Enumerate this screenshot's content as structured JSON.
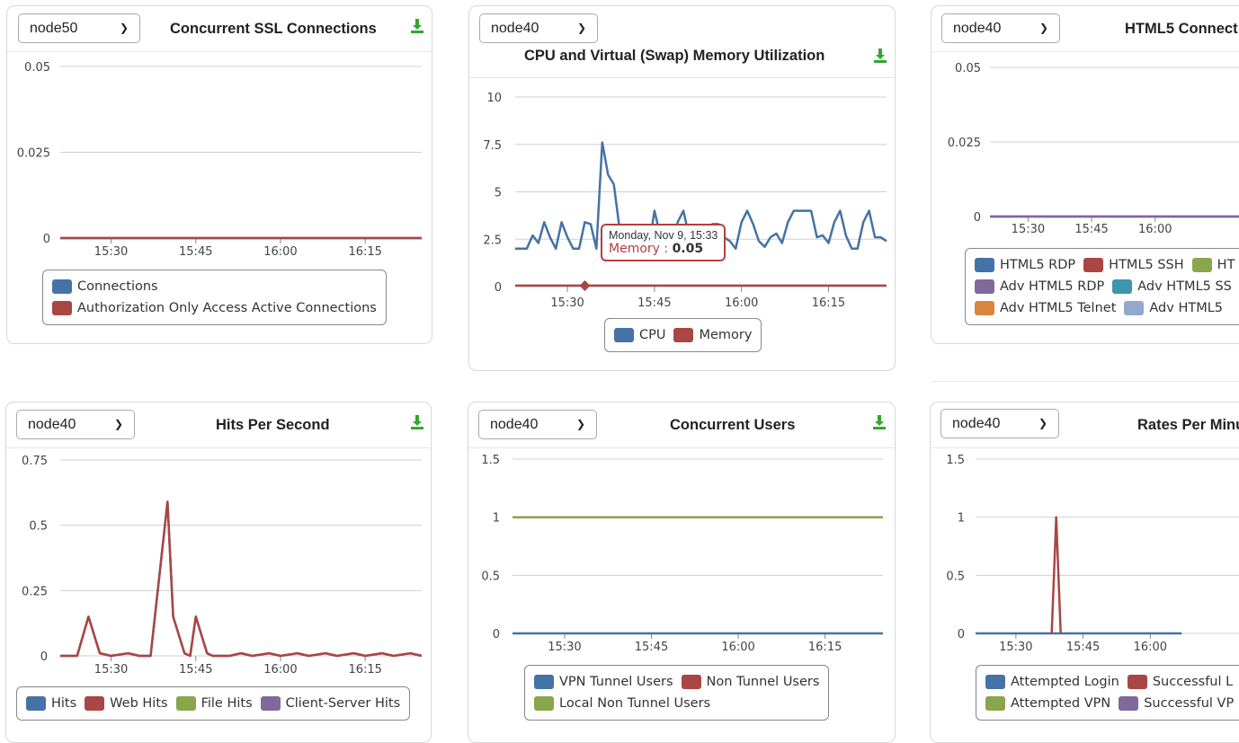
{
  "colors": {
    "blue": "#4572a7",
    "red": "#aa4643",
    "green": "#89a54e",
    "purple": "#80699b",
    "teal": "#3d96ae",
    "orange": "#db843d",
    "lightblue": "#92a8cd",
    "download": "#33a532"
  },
  "panels": [
    {
      "node": "node50",
      "title": "Concurrent SSL Connections",
      "icon": "download-icon",
      "legend_rows": [
        [
          "Connections"
        ],
        [
          "Authorization Only Access Active Connections"
        ]
      ],
      "legend_colors": [
        [
          "blue"
        ],
        [
          "red"
        ]
      ]
    },
    {
      "node": "node40",
      "title": "CPU and Virtual (Swap) Memory Utilization",
      "icon": "download-icon",
      "legend_rows": [
        [
          "CPU",
          "Memory"
        ]
      ],
      "legend_colors": [
        [
          "blue",
          "red"
        ]
      ],
      "tooltip": {
        "date": "Monday, Nov 9, 15:33",
        "series": "Memory",
        "value": "0.05"
      }
    },
    {
      "node": "node40",
      "title": "HTML5 Connect",
      "legend_rows": [
        [
          "HTML5 RDP",
          "HTML5 SSH",
          "HT"
        ],
        [
          "Adv HTML5 RDP",
          "Adv HTML5 SS"
        ],
        [
          "Adv HTML5 Telnet",
          "Adv HTML5"
        ]
      ],
      "legend_colors": [
        [
          "blue",
          "red",
          "green"
        ],
        [
          "purple",
          "teal"
        ],
        [
          "orange",
          "lightblue"
        ]
      ]
    },
    {
      "node": "node40",
      "title": "Hits Per Second",
      "icon": "download-icon",
      "legend_rows": [
        [
          "Hits",
          "Web Hits",
          "File Hits",
          "Client-Server Hits"
        ]
      ],
      "legend_colors": [
        [
          "blue",
          "red",
          "green",
          "purple"
        ]
      ]
    },
    {
      "node": "node40",
      "title": "Concurrent Users",
      "icon": "download-icon",
      "legend_rows": [
        [
          "VPN Tunnel Users",
          "Non Tunnel Users"
        ],
        [
          "Local Non Tunnel Users"
        ]
      ],
      "legend_colors": [
        [
          "blue",
          "red"
        ],
        [
          "green"
        ]
      ]
    },
    {
      "node": "node40",
      "title": "Rates Per Minu",
      "legend_rows": [
        [
          "Attempted Login",
          "Successful L"
        ],
        [
          "Attempted VPN",
          "Successful VP"
        ]
      ],
      "legend_colors": [
        [
          "blue",
          "red"
        ],
        [
          "green",
          "purple"
        ]
      ]
    }
  ],
  "chart_data": [
    {
      "type": "line",
      "title": "Concurrent SSL Connections",
      "ylim": [
        0,
        0.05
      ],
      "yticks": [
        "0.05",
        "0.025",
        "0"
      ],
      "xticks": [
        "15:30",
        "15:45",
        "16:00",
        "16:15"
      ],
      "x_range": [
        "15:21",
        "16:25"
      ],
      "series": [
        {
          "name": "Connections",
          "color": "blue",
          "x": [
            "15:21",
            "16:25"
          ],
          "y": [
            0,
            0
          ]
        },
        {
          "name": "Authorization Only Access Active Connections",
          "color": "red",
          "x": [
            "15:21",
            "16:25"
          ],
          "y": [
            0,
            0
          ]
        }
      ]
    },
    {
      "type": "line",
      "title": "CPU and Virtual (Swap) Memory Utilization",
      "ylim": [
        0,
        10
      ],
      "yticks": [
        "10",
        "7.5",
        "5",
        "2.5",
        "0"
      ],
      "xticks": [
        "15:30",
        "15:45",
        "16:00",
        "16:15"
      ],
      "x_range": [
        "15:21",
        "16:25"
      ],
      "series": [
        {
          "name": "CPU",
          "color": "blue",
          "x": [
            "15:21",
            "15:22",
            "15:23",
            "15:24",
            "15:25",
            "15:26",
            "15:27",
            "15:28",
            "15:29",
            "15:30",
            "15:31",
            "15:32",
            "15:33",
            "15:34",
            "15:35",
            "15:36",
            "15:37",
            "15:38",
            "15:39",
            "15:40",
            "15:41",
            "15:42",
            "15:43",
            "15:44",
            "15:45",
            "15:46",
            "15:47",
            "15:48",
            "15:49",
            "15:50",
            "15:51",
            "15:52",
            "15:53",
            "15:54",
            "15:55",
            "15:56",
            "15:57",
            "15:58",
            "15:59",
            "16:00",
            "16:01",
            "16:02",
            "16:03",
            "16:04",
            "16:05",
            "16:06",
            "16:07",
            "16:08",
            "16:09",
            "16:10",
            "16:11",
            "16:12",
            "16:13",
            "16:14",
            "16:15",
            "16:16",
            "16:17",
            "16:18",
            "16:19",
            "16:20",
            "16:21",
            "16:22",
            "16:23",
            "16:24",
            "16:25"
          ],
          "y": [
            2.0,
            2.0,
            2.0,
            2.7,
            2.3,
            3.4,
            2.6,
            2.0,
            3.4,
            2.6,
            2.0,
            2.0,
            3.4,
            3.3,
            2.0,
            7.6,
            5.9,
            5.4,
            3.0,
            2.6,
            2.0,
            2.0,
            2.6,
            2.0,
            4.0,
            2.7,
            2.0,
            2.0,
            3.4,
            4.0,
            2.6,
            2.0,
            2.7,
            2.0,
            3.3,
            3.3,
            2.6,
            2.4,
            2.0,
            3.4,
            4.0,
            3.3,
            2.4,
            2.1,
            2.6,
            2.8,
            2.3,
            3.4,
            4.0,
            4.0,
            4.0,
            4.0,
            2.6,
            2.7,
            2.3,
            3.4,
            4.0,
            2.7,
            2.0,
            2.0,
            3.4,
            4.0,
            2.6,
            2.6,
            2.4
          ]
        },
        {
          "name": "Memory",
          "color": "red",
          "x": [
            "15:21",
            "16:25"
          ],
          "y": [
            0.05,
            0.05
          ]
        }
      ]
    },
    {
      "type": "line",
      "title": "HTML5 Connect",
      "ylim": [
        0,
        0.05
      ],
      "yticks": [
        "0.05",
        "0.025",
        "0"
      ],
      "xticks": [
        "15:30",
        "15:45",
        "16:00"
      ],
      "series": [
        {
          "name": "HTML5 RDP",
          "color": "blue",
          "y": [
            0,
            0
          ]
        },
        {
          "name": "Adv HTML5 RDP",
          "color": "purple",
          "y": [
            0,
            0
          ]
        }
      ]
    },
    {
      "type": "line",
      "title": "Hits Per Second",
      "ylim": [
        0,
        0.75
      ],
      "yticks": [
        "0.75",
        "0.5",
        "0.25",
        "0"
      ],
      "xticks": [
        "15:30",
        "15:45",
        "16:00",
        "16:15"
      ],
      "x_range": [
        "15:21",
        "16:25"
      ],
      "series": [
        {
          "name": "Hits",
          "color": "blue",
          "x": [
            "15:21",
            "15:24",
            "15:26",
            "15:28",
            "15:30",
            "15:33",
            "15:35",
            "15:37",
            "15:40",
            "15:41",
            "15:43",
            "15:44",
            "15:45",
            "15:47",
            "15:48",
            "15:51",
            "15:53",
            "15:55",
            "15:58",
            "16:00",
            "16:03",
            "16:05",
            "16:08",
            "16:10",
            "16:13",
            "16:15",
            "16:18",
            "16:20",
            "16:23",
            "16:25"
          ],
          "y": [
            0,
            0,
            0.15,
            0.01,
            0,
            0.01,
            0,
            0,
            0.59,
            0.15,
            0.01,
            0,
            0.15,
            0.01,
            0,
            0,
            0.01,
            0,
            0.01,
            0,
            0.01,
            0,
            0.01,
            0,
            0.01,
            0,
            0.01,
            0,
            0.01,
            0
          ]
        },
        {
          "name": "Web Hits",
          "color": "red",
          "x": [
            "15:21",
            "15:24",
            "15:26",
            "15:28",
            "15:30",
            "15:33",
            "15:35",
            "15:37",
            "15:40",
            "15:41",
            "15:43",
            "15:44",
            "15:45",
            "15:47",
            "15:48",
            "15:51",
            "15:53",
            "15:55",
            "15:58",
            "16:00",
            "16:03",
            "16:05",
            "16:08",
            "16:10",
            "16:13",
            "16:15",
            "16:18",
            "16:20",
            "16:23",
            "16:25"
          ],
          "y": [
            0,
            0,
            0.15,
            0.01,
            0,
            0.01,
            0,
            0,
            0.59,
            0.15,
            0.01,
            0,
            0.15,
            0.01,
            0,
            0,
            0.01,
            0,
            0.01,
            0,
            0.01,
            0,
            0.01,
            0,
            0.01,
            0,
            0.01,
            0,
            0.01,
            0
          ]
        }
      ]
    },
    {
      "type": "line",
      "title": "Concurrent Users",
      "ylim": [
        0,
        1.5
      ],
      "yticks": [
        "1.5",
        "1",
        "0.5",
        "0"
      ],
      "xticks": [
        "15:30",
        "15:45",
        "16:00",
        "16:15"
      ],
      "x_range": [
        "15:21",
        "16:25"
      ],
      "series": [
        {
          "name": "VPN Tunnel Users",
          "color": "blue",
          "x": [
            "15:21",
            "16:25"
          ],
          "y": [
            0,
            0
          ]
        },
        {
          "name": "Non Tunnel Users",
          "color": "red",
          "x": [
            "15:21",
            "16:25"
          ],
          "y": [
            1,
            1
          ]
        },
        {
          "name": "Local Non Tunnel Users",
          "color": "green",
          "x": [
            "15:21",
            "16:25"
          ],
          "y": [
            1,
            1
          ]
        }
      ]
    },
    {
      "type": "line",
      "title": "Rates Per Minu",
      "ylim": [
        0,
        1.5
      ],
      "yticks": [
        "1.5",
        "1",
        "0.5",
        "0"
      ],
      "xticks": [
        "15:30",
        "15:45",
        "16:00"
      ],
      "series": [
        {
          "name": "Attempted Login",
          "color": "blue",
          "x": [
            "15:21",
            "16:07"
          ],
          "y": [
            0,
            0
          ]
        },
        {
          "name": "Successful L",
          "color": "red",
          "x": [
            "15:38",
            "15:39",
            "15:40"
          ],
          "y": [
            0,
            1,
            0
          ]
        }
      ]
    }
  ]
}
